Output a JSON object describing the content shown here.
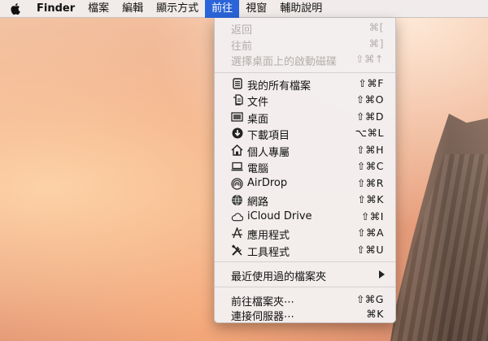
{
  "menubar": {
    "apple_icon": "apple-logo-icon",
    "items": [
      {
        "label": "Finder"
      },
      {
        "label": "檔案"
      },
      {
        "label": "編輯"
      },
      {
        "label": "顯示方式"
      },
      {
        "label": "前往"
      },
      {
        "label": "視窗"
      },
      {
        "label": "輔助說明"
      }
    ],
    "active_index": 4,
    "active_color": "#2a64d8"
  },
  "go_menu": {
    "items": [
      {
        "label": "返回",
        "shortcut": "⌘[",
        "enabled": false
      },
      {
        "label": "往前",
        "shortcut": "⌘]",
        "enabled": false
      },
      {
        "label": "選擇桌面上的啟動磁碟",
        "shortcut": "⇧⌘↑",
        "enabled": false
      },
      {
        "label": "我的所有檔案",
        "shortcut": "⇧⌘F",
        "icon": "all-files-icon"
      },
      {
        "label": "文件",
        "shortcut": "⇧⌘O",
        "icon": "documents-icon"
      },
      {
        "label": "桌面",
        "shortcut": "⇧⌘D",
        "icon": "desktop-icon"
      },
      {
        "label": "下載項目",
        "shortcut": "⌥⌘L",
        "icon": "downloads-icon"
      },
      {
        "label": "個人專屬",
        "shortcut": "⇧⌘H",
        "icon": "home-icon"
      },
      {
        "label": "電腦",
        "shortcut": "⇧⌘C",
        "icon": "computer-icon"
      },
      {
        "label": "AirDrop",
        "shortcut": "⇧⌘R",
        "icon": "airdrop-icon"
      },
      {
        "label": "網路",
        "shortcut": "⇧⌘K",
        "icon": "network-icon"
      },
      {
        "label": "iCloud Drive",
        "shortcut": "⇧⌘I",
        "icon": "icloud-icon"
      },
      {
        "label": "應用程式",
        "shortcut": "⇧⌘A",
        "icon": "applications-icon"
      },
      {
        "label": "工具程式",
        "shortcut": "⇧⌘U",
        "icon": "utilities-icon"
      },
      {
        "label": "最近使用過的檔案夾",
        "submenu": true
      },
      {
        "label": "前往檔案夾⋯",
        "shortcut": "⇧⌘G"
      },
      {
        "label": "連接伺服器⋯",
        "shortcut": "⌘K"
      }
    ]
  }
}
